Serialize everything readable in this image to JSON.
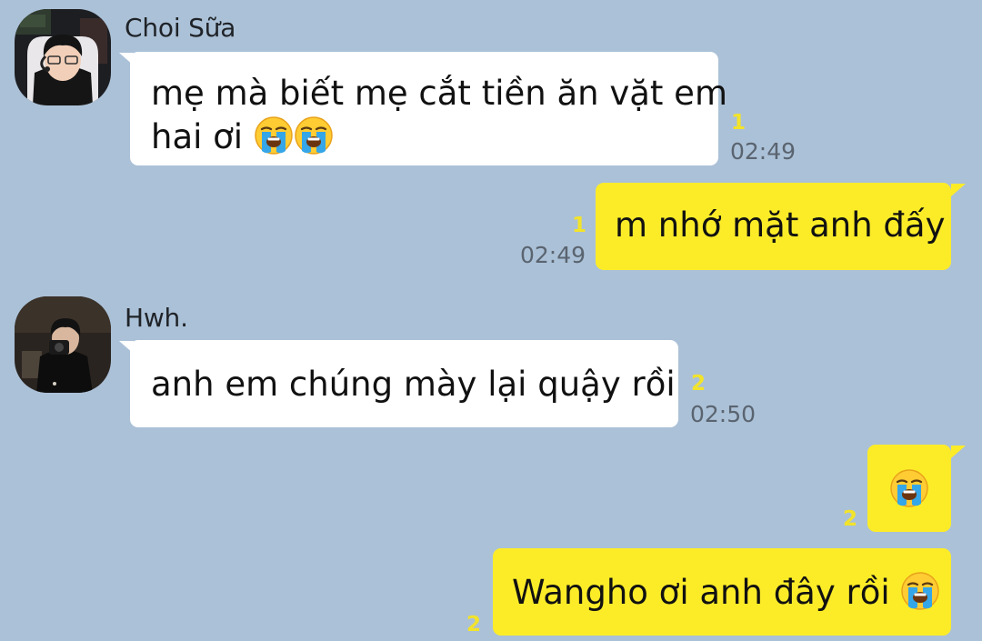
{
  "conversation": {
    "messages": [
      {
        "sender": "Choi Sữa",
        "direction": "incoming",
        "lines": [
          "mẹ mà biết mẹ cắt tiền ăn vặt em",
          "hai ơi"
        ],
        "trailing_emoji": [
          "loudly-crying-face-emoji",
          "loudly-crying-face-emoji"
        ],
        "unread": "1",
        "time": "02:49"
      },
      {
        "direction": "outgoing",
        "text": "m nhớ mặt anh đấy",
        "unread": "1",
        "time": "02:49"
      },
      {
        "sender": "Hwh.",
        "direction": "incoming",
        "text": "anh em chúng mày lại quậy rồi",
        "unread": "2",
        "time": "02:50"
      },
      {
        "direction": "outgoing",
        "text": "",
        "trailing_emoji": [
          "loudly-crying-face-emoji"
        ],
        "unread": "2"
      },
      {
        "direction": "outgoing",
        "text": "Wangho ơi anh đây rồi",
        "trailing_emoji": [
          "loudly-crying-face-emoji"
        ],
        "unread": "2"
      }
    ]
  },
  "colors": {
    "background": "#abc1d7",
    "incoming_bubble": "#ffffff",
    "outgoing_bubble": "#fcec28",
    "unread_count": "#f2e32b",
    "timestamp": "#5a6470"
  }
}
